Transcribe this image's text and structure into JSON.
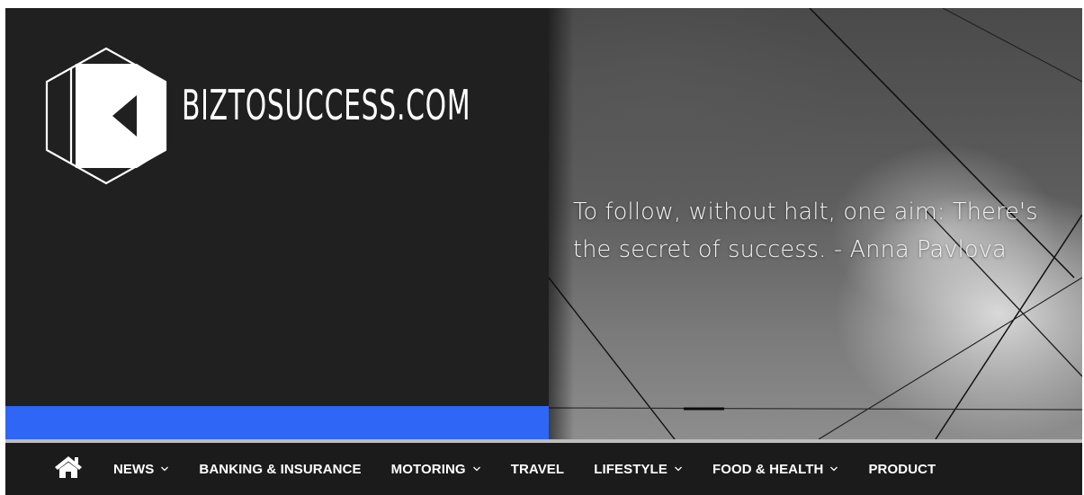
{
  "site": {
    "logo_text": "BIZTOSUCCESS.COM",
    "quote_line1": "To follow, without halt, one aim: There's",
    "quote_line2": "the secret of success. - Anna Pavlova"
  },
  "colors": {
    "accent": "#2f66f5",
    "header_dark": "#202020",
    "nav_bg": "#1b1b1b"
  },
  "nav": {
    "home_icon": "home-icon",
    "items": [
      {
        "label": "NEWS",
        "has_dropdown": true
      },
      {
        "label": "BANKING & INSURANCE",
        "has_dropdown": false
      },
      {
        "label": "MOTORING",
        "has_dropdown": true
      },
      {
        "label": "TRAVEL",
        "has_dropdown": false
      },
      {
        "label": "LIFESTYLE",
        "has_dropdown": true
      },
      {
        "label": "FOOD & HEALTH",
        "has_dropdown": true
      },
      {
        "label": "PRODUCT",
        "has_dropdown": false
      }
    ]
  }
}
